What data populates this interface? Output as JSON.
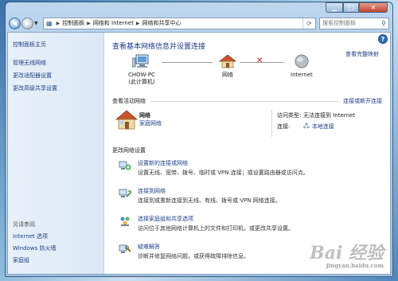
{
  "address": {
    "crumbs": [
      "控制面板",
      "网络和 Internet",
      "网络和共享中心"
    ],
    "search_placeholder": "搜索控制面板"
  },
  "sidebar": {
    "home": "控制面板主页",
    "items": [
      "管理无线网络",
      "更改适配器设置",
      "更改高级共享设置"
    ],
    "see_also_title": "另请参阅",
    "see_also": [
      "Internet 选项",
      "Windows 防火墙",
      "家庭组"
    ]
  },
  "main": {
    "title": "查看基本网络信息并设置连接",
    "full_map": "查看完整映射",
    "map": {
      "computer": "CHOW-PC",
      "computer_sub": "(此计算机)",
      "network": "网络",
      "internet": "Internet"
    },
    "active_section": {
      "title": "查看活动网络",
      "right_link": "连接或断开连接",
      "network_name": "网络",
      "network_type": "家庭网络",
      "access_type_label": "访问类型:",
      "access_type_value": "无法连接到 Internet",
      "connections_label": "连接:",
      "connections_value": "本地连接"
    },
    "change_section_title": "更改网络设置",
    "tasks": [
      {
        "icon": "network-setup-icon",
        "link": "设置新的连接或网络",
        "desc": "设置无线、宽带、拨号、临时或 VPN 连接；或设置路由器或访问点。"
      },
      {
        "icon": "connect-network-icon",
        "link": "连接到网络",
        "desc": "连接到或重新连接到无线、有线、拨号或 VPN 网络连接。"
      },
      {
        "icon": "homegroup-icon",
        "link": "选择家庭组和共享选项",
        "desc": "访问位于其他网络计算机上的文件和打印机，或更改共享设置。"
      },
      {
        "icon": "troubleshoot-icon",
        "link": "疑难解答",
        "desc": "诊断并修复网络问题，或获得故障排除信息。"
      }
    ]
  },
  "watermark": {
    "text": "Bai 经验",
    "sub": "jingyan.baidu.com"
  }
}
